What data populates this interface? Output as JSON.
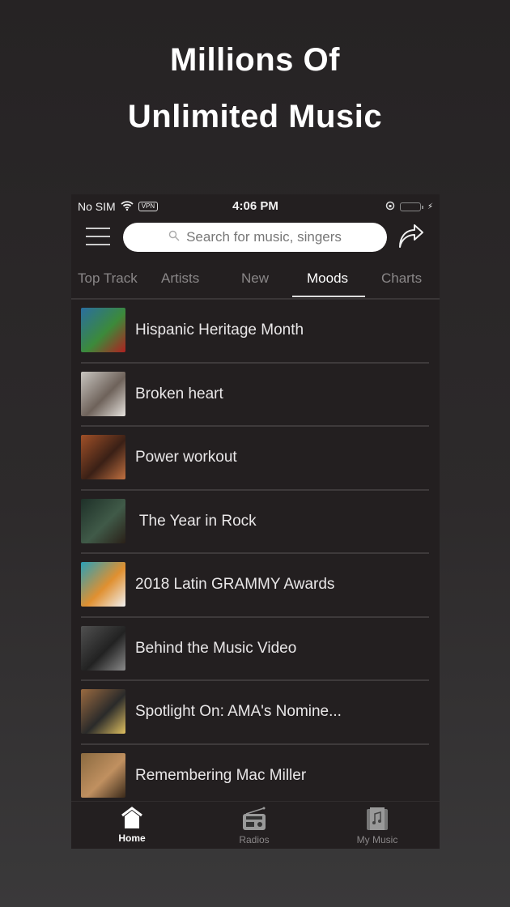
{
  "promo": {
    "line1": "Millions Of",
    "line2": "Unlimited Music"
  },
  "status_bar": {
    "carrier": "No SIM",
    "vpn": "VPN",
    "time": "4:06 PM",
    "battery_color": "#4cd964"
  },
  "search": {
    "placeholder": "Search for music, singers"
  },
  "tabs": [
    {
      "label": "Top Track",
      "active": false
    },
    {
      "label": "Artists",
      "active": false
    },
    {
      "label": "New",
      "active": false
    },
    {
      "label": "Moods",
      "active": true
    },
    {
      "label": "Charts",
      "active": false
    }
  ],
  "moods": [
    {
      "title": "Hispanic Heritage Month",
      "thumb_colors": [
        "#2a6ea0",
        "#3c8a3a",
        "#b02020"
      ]
    },
    {
      "title": "Broken heart",
      "thumb_colors": [
        "#c8c5c0",
        "#6e625a",
        "#e6e2dd"
      ]
    },
    {
      "title": "Power workout",
      "thumb_colors": [
        "#a05028",
        "#3a2016",
        "#c07040"
      ]
    },
    {
      "title": " The Year in Rock",
      "thumb_colors": [
        "#1e3028",
        "#405a48",
        "#2a2018"
      ]
    },
    {
      "title": "2018 Latin GRAMMY Awards",
      "thumb_colors": [
        "#2aa0b8",
        "#e09030",
        "#f0f0f0"
      ]
    },
    {
      "title": "Behind the Music Video",
      "thumb_colors": [
        "#505050",
        "#222222",
        "#8a8a8a"
      ]
    },
    {
      "title": "Spotlight On: AMA's Nomine...",
      "thumb_colors": [
        "#9a6a40",
        "#2a2a2a",
        "#e0c060"
      ]
    },
    {
      "title": "Remembering Mac Miller",
      "thumb_colors": [
        "#8a6a40",
        "#c09060",
        "#3a2a1a"
      ]
    }
  ],
  "tabbar": [
    {
      "label": "Home",
      "icon": "home-icon",
      "active": true
    },
    {
      "label": "Radios",
      "icon": "radio-icon",
      "active": false
    },
    {
      "label": "My Music",
      "icon": "music-album-icon",
      "active": false
    }
  ]
}
